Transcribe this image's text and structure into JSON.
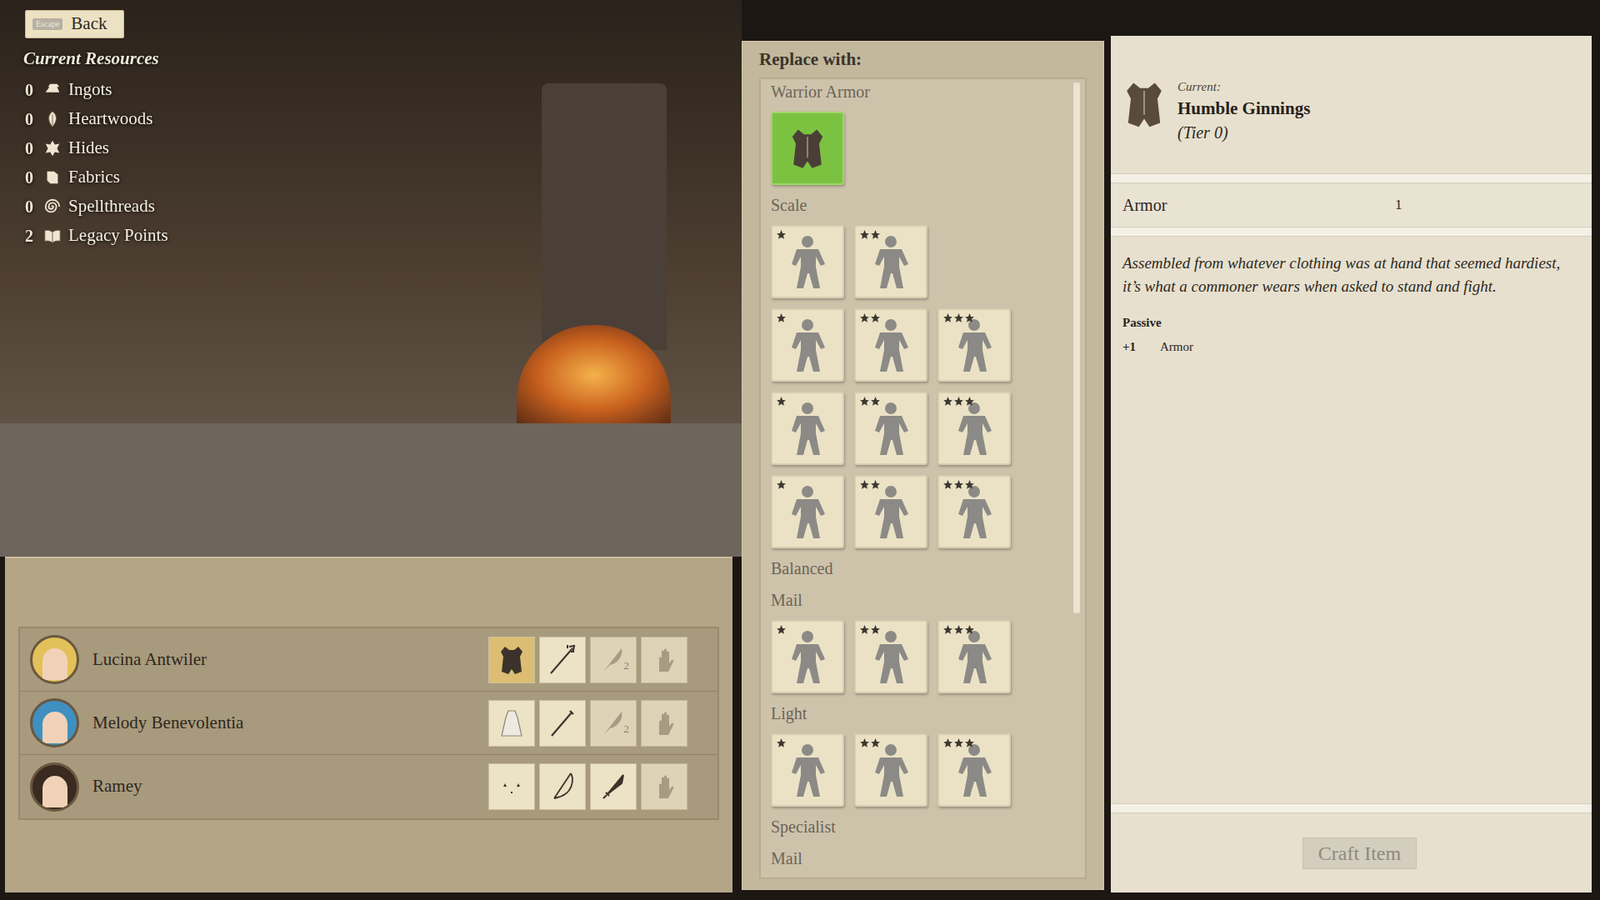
{
  "back_button": {
    "key": "Escape",
    "label": "Back"
  },
  "resources": {
    "title": "Current Resources",
    "items": [
      {
        "count": "0",
        "label": "Ingots",
        "kind": "ingot"
      },
      {
        "count": "0",
        "label": "Heartwoods",
        "kind": "leaf"
      },
      {
        "count": "0",
        "label": "Hides",
        "kind": "hide"
      },
      {
        "count": "0",
        "label": "Fabrics",
        "kind": "fabric"
      },
      {
        "count": "0",
        "label": "Spellthreads",
        "kind": "spiral"
      },
      {
        "count": "2",
        "label": "Legacy Points",
        "kind": "book"
      }
    ]
  },
  "party": [
    {
      "name": "Lucina Antwiler",
      "color": "#e2c15a",
      "slots": [
        {
          "kind": "armor",
          "selected": true,
          "dimmed": false,
          "badge": ""
        },
        {
          "kind": "spear",
          "selected": false,
          "dimmed": false,
          "badge": ""
        },
        {
          "kind": "quill",
          "selected": false,
          "dimmed": true,
          "badge": "2"
        },
        {
          "kind": "hand",
          "selected": false,
          "dimmed": true,
          "badge": ""
        }
      ]
    },
    {
      "name": "Melody Benevolentia",
      "color": "#3f8fc0",
      "slots": [
        {
          "kind": "robe",
          "selected": false,
          "dimmed": false,
          "badge": ""
        },
        {
          "kind": "staff",
          "selected": false,
          "dimmed": false,
          "badge": ""
        },
        {
          "kind": "quill",
          "selected": false,
          "dimmed": true,
          "badge": "2"
        },
        {
          "kind": "hand",
          "selected": false,
          "dimmed": true,
          "badge": ""
        }
      ]
    },
    {
      "name": "Ramey",
      "color": "#3a2a20",
      "slots": [
        {
          "kind": "cloak",
          "selected": false,
          "dimmed": false,
          "badge": ""
        },
        {
          "kind": "bow",
          "selected": false,
          "dimmed": false,
          "badge": ""
        },
        {
          "kind": "dagger",
          "selected": false,
          "dimmed": false,
          "badge": ""
        },
        {
          "kind": "hand",
          "selected": false,
          "dimmed": true,
          "badge": ""
        }
      ]
    }
  ],
  "replace_panel": {
    "title": "Replace with:",
    "scrollbar": {
      "level": 0.67
    },
    "blocks": [
      {
        "kind": "label",
        "text": "Warrior Armor",
        "rows": []
      },
      {
        "kind": "tiles",
        "text": "",
        "rows": [
          [
            {
              "stars": 0,
              "selected": true,
              "locked": false
            }
          ]
        ]
      },
      {
        "kind": "label",
        "text": "Scale",
        "rows": []
      },
      {
        "kind": "tiles",
        "text": "",
        "rows": [
          [
            {
              "stars": 1,
              "selected": false,
              "locked": true
            },
            {
              "stars": 2,
              "selected": false,
              "locked": true
            }
          ],
          [
            {
              "stars": 1,
              "selected": false,
              "locked": true
            },
            {
              "stars": 2,
              "selected": false,
              "locked": true
            },
            {
              "stars": 3,
              "selected": false,
              "locked": true
            }
          ],
          [
            {
              "stars": 1,
              "selected": false,
              "locked": true
            },
            {
              "stars": 2,
              "selected": false,
              "locked": true
            },
            {
              "stars": 3,
              "selected": false,
              "locked": true
            }
          ],
          [
            {
              "stars": 1,
              "selected": false,
              "locked": true
            },
            {
              "stars": 2,
              "selected": false,
              "locked": true
            },
            {
              "stars": 3,
              "selected": false,
              "locked": true
            }
          ]
        ]
      },
      {
        "kind": "label",
        "text": "Balanced",
        "rows": []
      },
      {
        "kind": "label",
        "text": "Mail",
        "rows": []
      },
      {
        "kind": "tiles",
        "text": "",
        "rows": [
          [
            {
              "stars": 1,
              "selected": false,
              "locked": true
            },
            {
              "stars": 2,
              "selected": false,
              "locked": true
            },
            {
              "stars": 3,
              "selected": false,
              "locked": true
            }
          ]
        ]
      },
      {
        "kind": "label",
        "text": "Light",
        "rows": []
      },
      {
        "kind": "tiles",
        "text": "",
        "rows": [
          [
            {
              "stars": 1,
              "selected": false,
              "locked": true
            },
            {
              "stars": 2,
              "selected": false,
              "locked": true
            },
            {
              "stars": 3,
              "selected": false,
              "locked": true
            }
          ]
        ]
      },
      {
        "kind": "label",
        "text": "Specialist",
        "rows": []
      },
      {
        "kind": "label",
        "text": "Mail",
        "rows": []
      }
    ]
  },
  "details": {
    "current_label": "Current:",
    "name": "Humble Ginnings",
    "tier": "(Tier 0)",
    "stats": [
      {
        "label": "Armor",
        "value": "1"
      }
    ],
    "description": "Assembled from whatever clothing was at hand that seemed hardiest, it’s what a commoner wears when asked to stand and fight.",
    "passive": {
      "title": "Passive",
      "effects": [
        {
          "value": "+1",
          "label": "Armor"
        }
      ]
    },
    "craft_button": {
      "label": "Craft Item",
      "disabled": true
    }
  }
}
